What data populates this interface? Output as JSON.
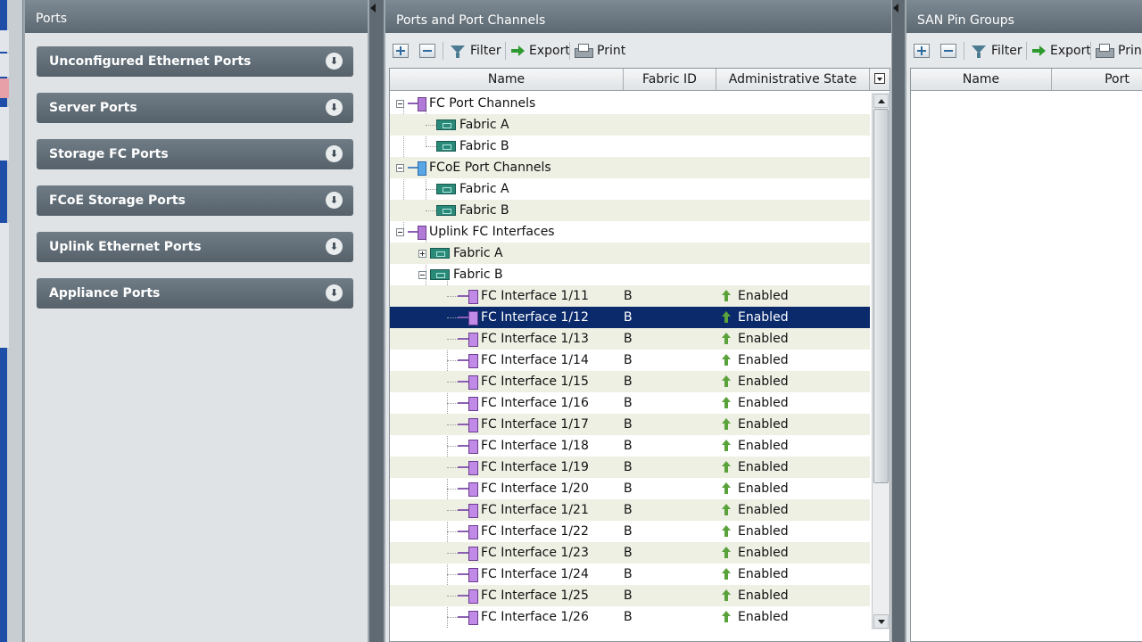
{
  "ports_panel": {
    "title": "Ports",
    "sections": [
      {
        "label": "Unconfigured Ethernet Ports"
      },
      {
        "label": "Server Ports"
      },
      {
        "label": "Storage FC Ports"
      },
      {
        "label": "FCoE Storage Ports"
      },
      {
        "label": "Uplink Ethernet Ports"
      },
      {
        "label": "Appliance Ports"
      }
    ]
  },
  "main_panel": {
    "title": "Ports and Port Channels",
    "toolbar": {
      "add": "add",
      "remove": "remove",
      "filter": "Filter",
      "export": "Export",
      "print": "Print"
    },
    "columns": {
      "name": "Name",
      "fabric": "Fabric ID",
      "state": "Administrative State"
    },
    "groups": {
      "fc_pc": "FC Port Channels",
      "fcoe_pc": "FCoE Port Channels",
      "uplink_fc": "Uplink FC Interfaces",
      "fabric_a": "Fabric A",
      "fabric_b": "Fabric B"
    },
    "interfaces": [
      {
        "name": "FC Interface 1/11",
        "fabric": "B",
        "state": "Enabled"
      },
      {
        "name": "FC Interface 1/12",
        "fabric": "B",
        "state": "Enabled"
      },
      {
        "name": "FC Interface 1/13",
        "fabric": "B",
        "state": "Enabled"
      },
      {
        "name": "FC Interface 1/14",
        "fabric": "B",
        "state": "Enabled"
      },
      {
        "name": "FC Interface 1/15",
        "fabric": "B",
        "state": "Enabled"
      },
      {
        "name": "FC Interface 1/16",
        "fabric": "B",
        "state": "Enabled"
      },
      {
        "name": "FC Interface 1/17",
        "fabric": "B",
        "state": "Enabled"
      },
      {
        "name": "FC Interface 1/18",
        "fabric": "B",
        "state": "Enabled"
      },
      {
        "name": "FC Interface 1/19",
        "fabric": "B",
        "state": "Enabled"
      },
      {
        "name": "FC Interface 1/20",
        "fabric": "B",
        "state": "Enabled"
      },
      {
        "name": "FC Interface 1/21",
        "fabric": "B",
        "state": "Enabled"
      },
      {
        "name": "FC Interface 1/22",
        "fabric": "B",
        "state": "Enabled"
      },
      {
        "name": "FC Interface 1/23",
        "fabric": "B",
        "state": "Enabled"
      },
      {
        "name": "FC Interface 1/24",
        "fabric": "B",
        "state": "Enabled"
      },
      {
        "name": "FC Interface 1/25",
        "fabric": "B",
        "state": "Enabled"
      },
      {
        "name": "FC Interface 1/26",
        "fabric": "B",
        "state": "Enabled"
      }
    ],
    "selected_row": "FC Interface 1/12"
  },
  "san_panel": {
    "title": "SAN Pin Groups",
    "toolbar": {
      "filter": "Filter",
      "export": "Export",
      "print": "Prin"
    },
    "columns": {
      "name": "Name",
      "port": "Port"
    }
  },
  "colors": {
    "selection": "#0a2a6b",
    "header": "#5d6972",
    "enabled_arrow": "#5aa23a"
  }
}
